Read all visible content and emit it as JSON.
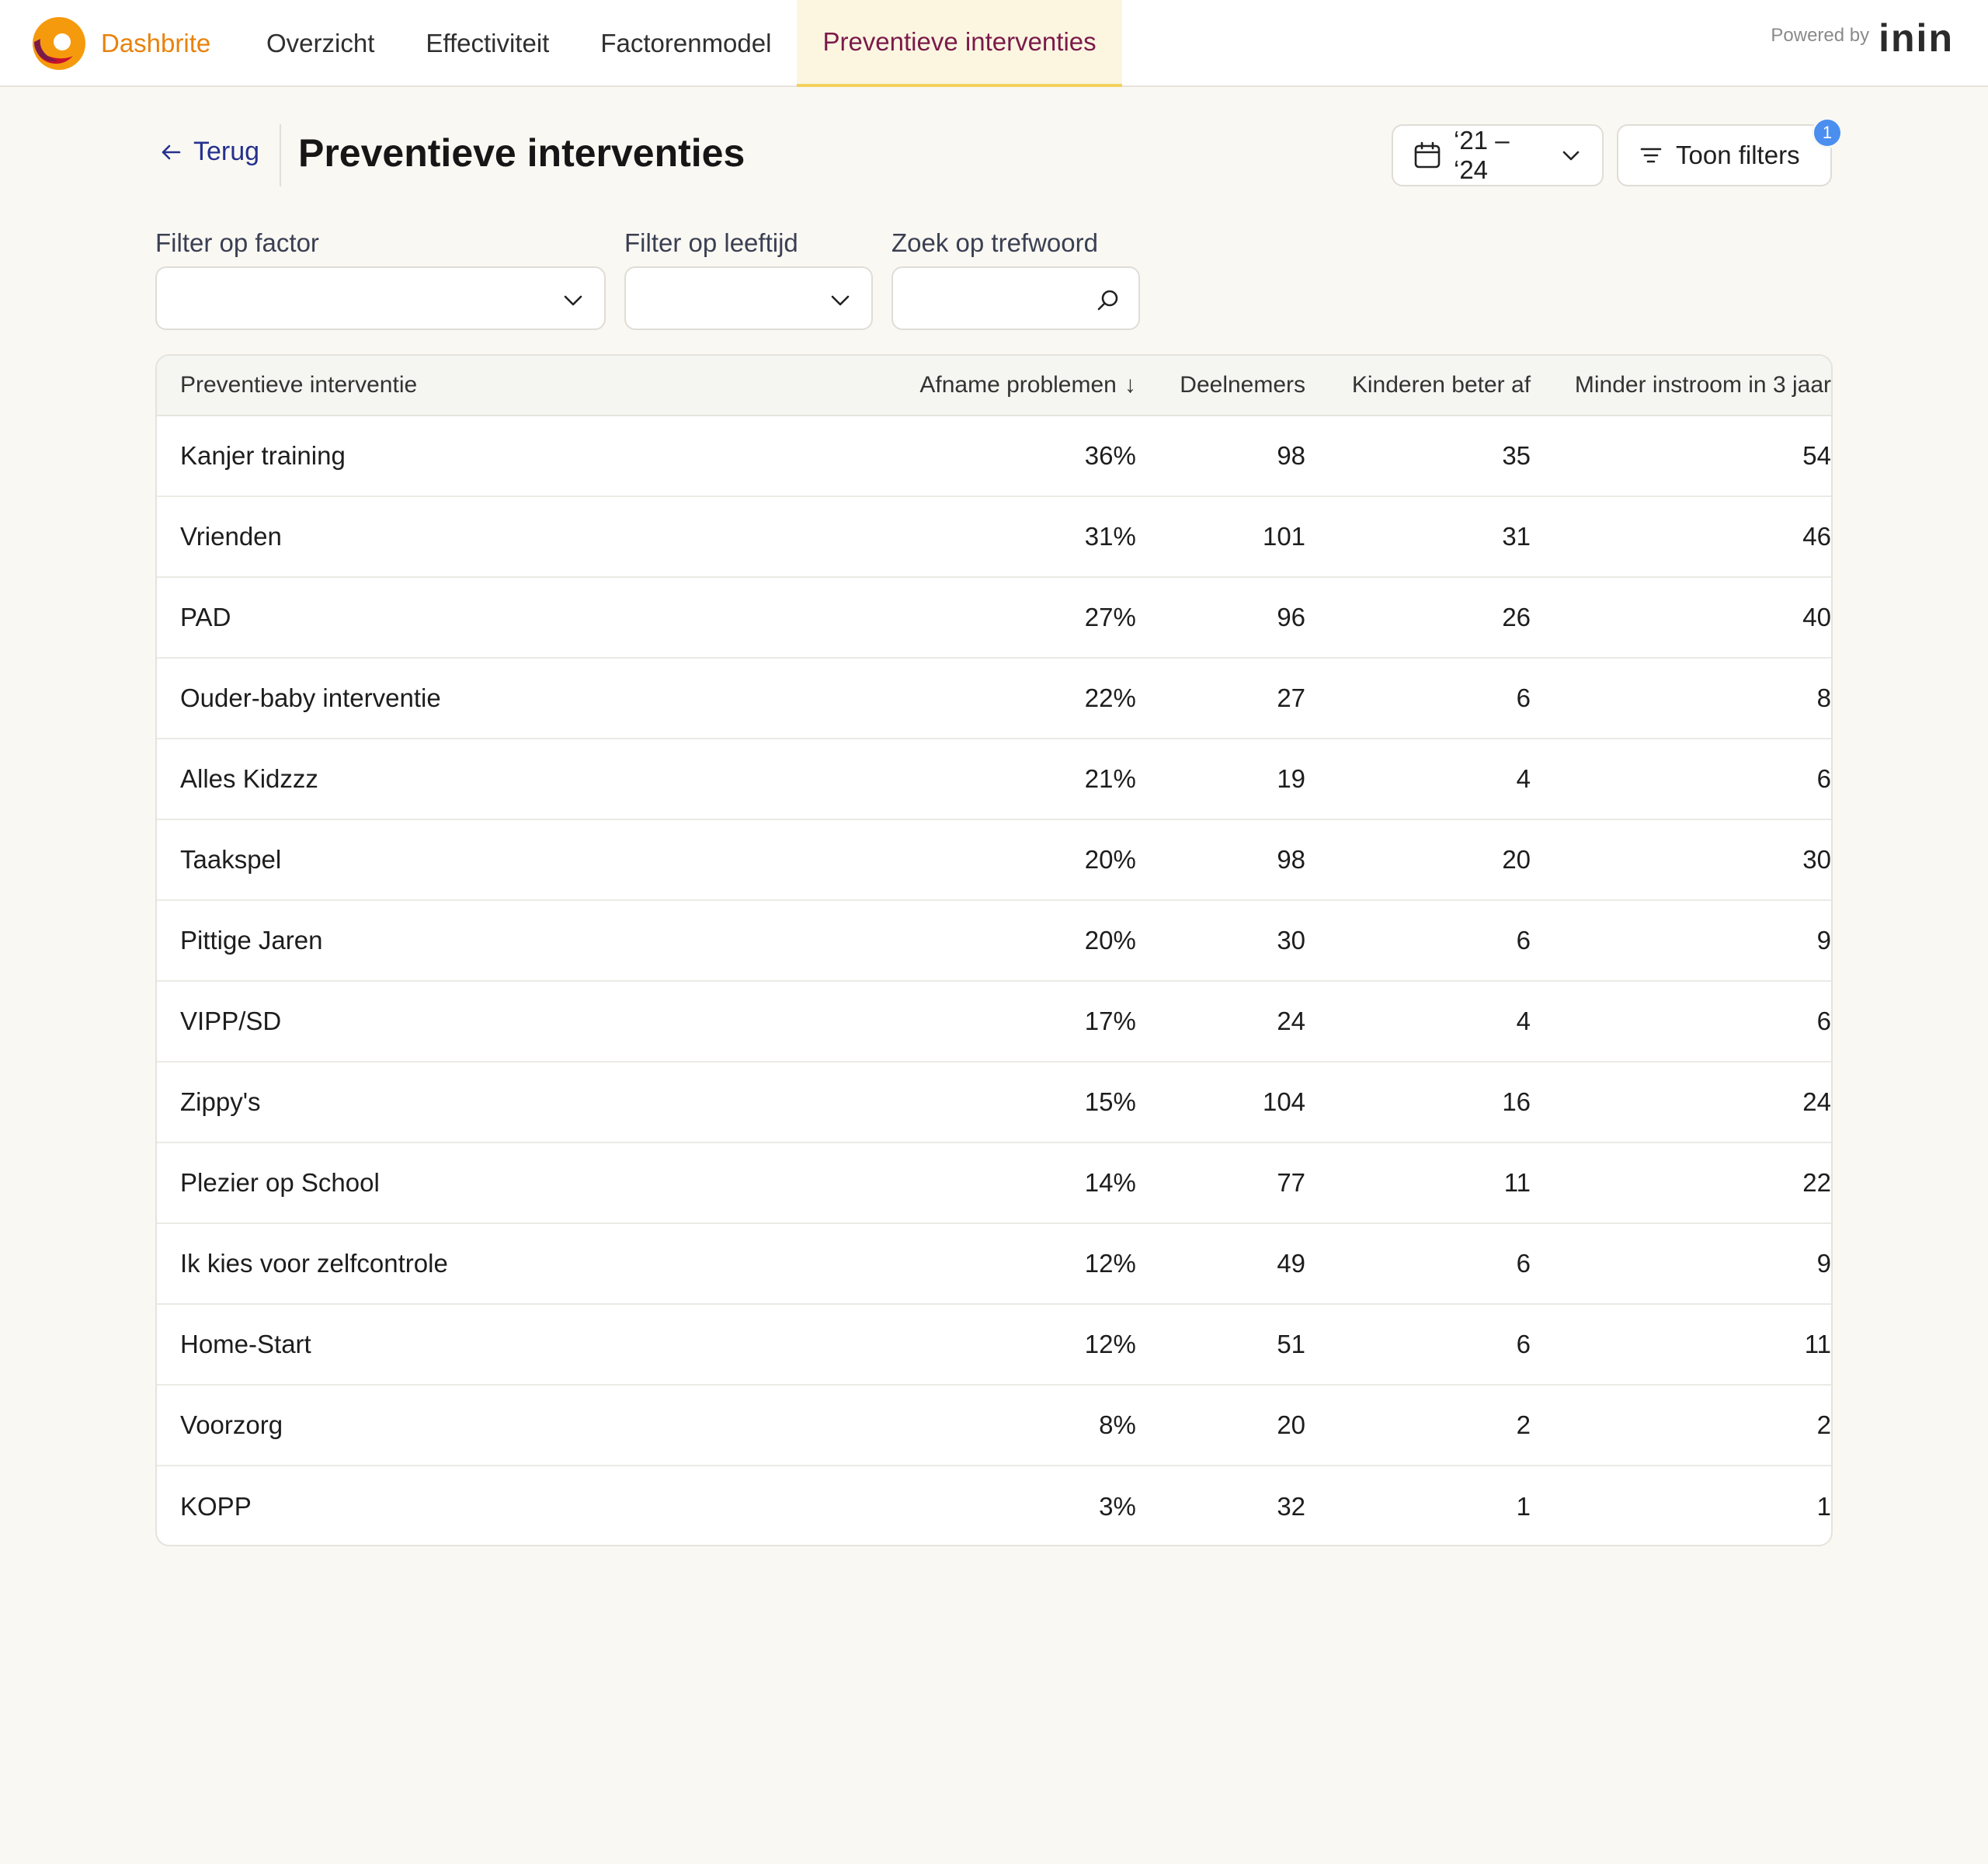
{
  "brand": {
    "name": "Dashbrite"
  },
  "nav": {
    "items": [
      {
        "label": "Overzicht"
      },
      {
        "label": "Effectiviteit"
      },
      {
        "label": "Factorenmodel"
      },
      {
        "label": "Preventieve interventies"
      }
    ],
    "active_index": 3
  },
  "powered": {
    "label": "Powered by",
    "logo_text": "inin"
  },
  "header": {
    "back_label": "Terug",
    "title": "Preventieve interventies",
    "date_range": "‘21 – ‘24",
    "filters_label": "Toon filters",
    "filters_count": "1"
  },
  "filters": {
    "factor_label": "Filter op factor",
    "factor_value": "",
    "age_label": "Filter op leeftijd",
    "age_value": "",
    "search_label": "Zoek op trefwoord",
    "search_value": ""
  },
  "table": {
    "columns": [
      "Preventieve interventie",
      "Afname problemen",
      "Deelnemers",
      "Kinderen beter af",
      "Minder instroom in 3 jaar"
    ],
    "sort_indicator": "↓",
    "rows": [
      [
        "Kanjer training",
        "36%",
        "98",
        "35",
        "54"
      ],
      [
        "Vrienden",
        "31%",
        "101",
        "31",
        "46"
      ],
      [
        "PAD",
        "27%",
        "96",
        "26",
        "40"
      ],
      [
        "Ouder-baby interventie",
        "22%",
        "27",
        "6",
        "8"
      ],
      [
        "Alles Kidzzz",
        "21%",
        "19",
        "4",
        "6"
      ],
      [
        "Taakspel",
        "20%",
        "98",
        "20",
        "30"
      ],
      [
        "Pittige Jaren",
        "20%",
        "30",
        "6",
        "9"
      ],
      [
        "VIPP/SD",
        "17%",
        "24",
        "4",
        "6"
      ],
      [
        "Zippy's",
        "15%",
        "104",
        "16",
        "24"
      ],
      [
        "Plezier op School",
        "14%",
        "77",
        "11",
        "22"
      ],
      [
        "Ik kies voor zelfcontrole",
        "12%",
        "49",
        "6",
        "9"
      ],
      [
        "Home-Start",
        "12%",
        "51",
        "6",
        "11"
      ],
      [
        "Voorzorg",
        "8%",
        "20",
        "2",
        "2"
      ],
      [
        "KOPP",
        "3%",
        "32",
        "1",
        "1"
      ]
    ]
  },
  "colors": {
    "brand_orange": "#e8820c",
    "active_nav_text": "#7b1a4a",
    "active_nav_underline": "#f2d25d",
    "link_blue": "#24318f",
    "badge_blue": "#4a8ef0"
  },
  "icons": {
    "back": "arrow-left-icon",
    "date": "calendar-icon",
    "dropdown": "chevron-down-icon",
    "filters": "filter-lines-icon",
    "search": "search-icon",
    "logo": "dashbrite-logo"
  }
}
